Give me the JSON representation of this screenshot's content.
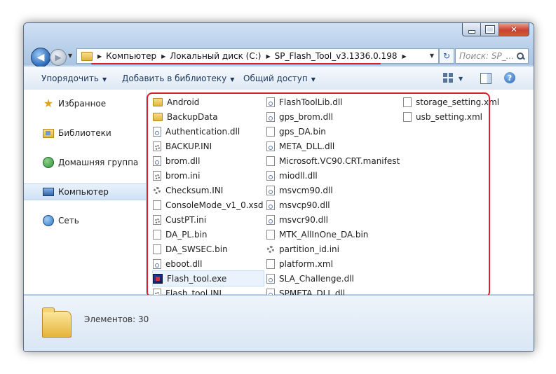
{
  "window": {
    "controls": {
      "minimize": "",
      "maximize": "",
      "close": "✕"
    }
  },
  "nav": {
    "back": "◀",
    "forward": "▶",
    "history_dropdown": "▼"
  },
  "address_bar": {
    "crumbs": [
      "Компьютер",
      "Локальный диск (C:)",
      "SP_Flash_Tool_v3.1336.0.198"
    ],
    "separator": "▶",
    "dropdown": "▼",
    "refresh": "↻"
  },
  "search": {
    "placeholder": "Поиск: SP_..."
  },
  "toolbar": {
    "organize": "Упорядочить",
    "add_library": "Добавить в библиотеку",
    "share": "Общий доступ",
    "caret": "▼",
    "help": "?"
  },
  "sidebar": {
    "items": [
      {
        "label": "Избранное",
        "icon": "star-icon"
      },
      {
        "label": "Библиотеки",
        "icon": "library-icon"
      },
      {
        "label": "Домашняя группа",
        "icon": "homegroup-icon"
      },
      {
        "label": "Компьютер",
        "icon": "computer-icon"
      },
      {
        "label": "Сеть",
        "icon": "network-icon"
      }
    ]
  },
  "files": {
    "col1": [
      {
        "name": "Android",
        "type": "folder"
      },
      {
        "name": "BackupData",
        "type": "folder"
      },
      {
        "name": "Authentication.dll",
        "type": "dll"
      },
      {
        "name": "BACKUP.INI",
        "type": "ini"
      },
      {
        "name": "brom.dll",
        "type": "dll"
      },
      {
        "name": "brom.ini",
        "type": "ini"
      },
      {
        "name": "Checksum.INI",
        "type": "gear"
      },
      {
        "name": "ConsoleMode_v1_0.xsd",
        "type": "doc"
      },
      {
        "name": "CustPT.ini",
        "type": "ini"
      },
      {
        "name": "DA_PL.bin",
        "type": "doc"
      },
      {
        "name": "DA_SWSEC.bin",
        "type": "doc"
      },
      {
        "name": "eboot.dll",
        "type": "dll"
      },
      {
        "name": "Flash_tool.exe",
        "type": "exe"
      },
      {
        "name": "Flash_tool.INI",
        "type": "ini"
      }
    ],
    "col2": [
      {
        "name": "FlashToolLib.dll",
        "type": "dll"
      },
      {
        "name": "gps_brom.dll",
        "type": "dll"
      },
      {
        "name": "gps_DA.bin",
        "type": "doc"
      },
      {
        "name": "META_DLL.dll",
        "type": "dll"
      },
      {
        "name": "Microsoft.VC90.CRT.manifest",
        "type": "doc"
      },
      {
        "name": "miodll.dll",
        "type": "dll"
      },
      {
        "name": "msvcm90.dll",
        "type": "dll"
      },
      {
        "name": "msvcp90.dll",
        "type": "dll"
      },
      {
        "name": "msvcr90.dll",
        "type": "dll"
      },
      {
        "name": "MTK_AllInOne_DA.bin",
        "type": "doc"
      },
      {
        "name": "partition_id.ini",
        "type": "gear"
      },
      {
        "name": "platform.xml",
        "type": "doc"
      },
      {
        "name": "SLA_Challenge.dll",
        "type": "dll"
      },
      {
        "name": "SPMETA_DLL.dll",
        "type": "dll"
      }
    ],
    "col3": [
      {
        "name": "storage_setting.xml",
        "type": "doc"
      },
      {
        "name": "usb_setting.xml",
        "type": "doc"
      }
    ],
    "selected": "Flash_tool.exe"
  },
  "details": {
    "count": "Элементов: 30"
  }
}
